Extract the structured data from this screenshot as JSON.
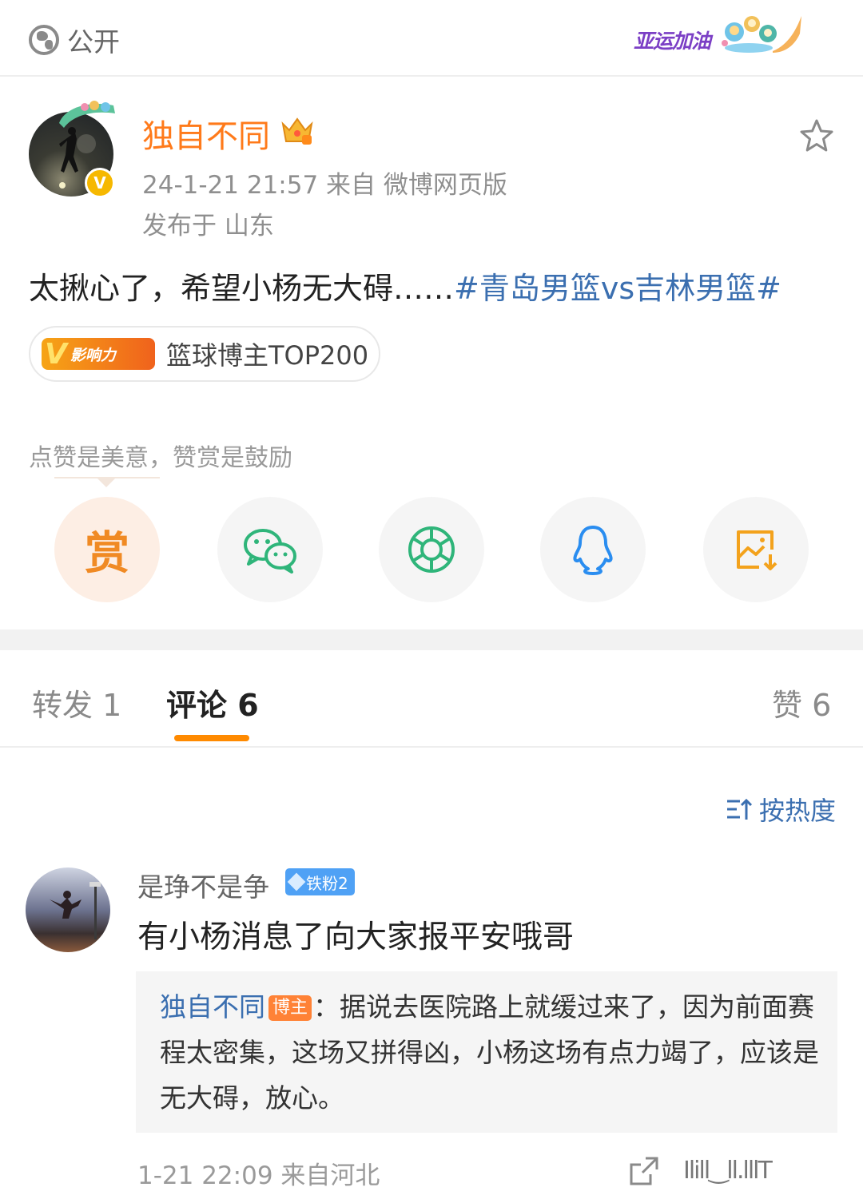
{
  "header": {
    "visibility_label": "公开",
    "banner_text": "亚运加油"
  },
  "post": {
    "author": "独自不同",
    "verified_mark": "V",
    "meta": "24-1-21 21:57   来自 微博网页版",
    "location": "发布于 山东",
    "text": "太揪心了，希望小杨无大碍……",
    "hashtag": "#青岛男篮vs吉林男篮#",
    "influence_badge": {
      "letter": "V",
      "label": "影响力"
    },
    "influence_text": "篮球博主TOP200",
    "reward_hint": "点赞是美意，赞赏是鼓励",
    "reward_char": "赏"
  },
  "share_icons": [
    "reward-icon",
    "wechat-icon",
    "moments-icon",
    "qq-icon",
    "save-image-icon"
  ],
  "tabs": {
    "repost": "转发 1",
    "comments": "评论 6",
    "likes": "赞 6"
  },
  "sort_label": "按热度",
  "comment": {
    "author": "是琤不是争",
    "fan_badge": "铁粉2",
    "text": "有小杨消息了向大家报平安哦哥",
    "reply": {
      "author": "独自不同",
      "host_badge": "博主",
      "text": "：据说去医院路上就缓过来了，因为前面赛程太密集，这场又拼得凶，小杨这场有点力竭了，应该是无大碍，放心。"
    },
    "meta": "1-21 22:09  来自河北",
    "trailing_text": "Ilill‿ll.lllT"
  },
  "colors": {
    "accent_orange": "#ff7a1a",
    "link_blue": "#3b6fb0",
    "tab_underline": "#ff8a00"
  }
}
